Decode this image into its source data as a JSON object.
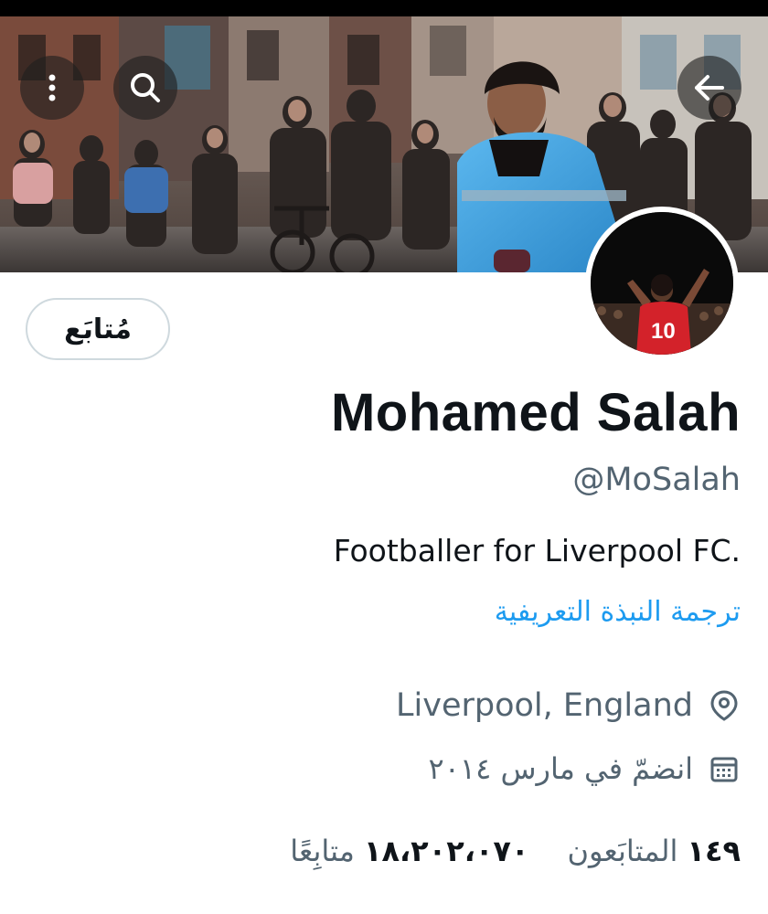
{
  "header": {
    "more_icon": "more-vertical-icon",
    "search_icon": "search-icon",
    "back_icon": "arrow-back-icon"
  },
  "profile": {
    "display_name": "Mohamed Salah",
    "handle": "@MoSalah",
    "bio": "Footballer for Liverpool FC.",
    "translate_bio_label": "ترجمة النبذة التعريفية",
    "location": "Liverpool, England",
    "location_icon": "location-pin-icon",
    "joined": "انضمّ في مارس ٢٠١٤",
    "joined_icon": "calendar-icon",
    "follow_button_label": "مُتابَع"
  },
  "stats": {
    "following_count": "١٤٩",
    "following_label": "المتابَعون",
    "followers_count": "١٨،٢٠٢،٠٧٠",
    "followers_label": "متابِعًا"
  },
  "colors": {
    "link": "#1d9bf0",
    "secondary_text": "#536471",
    "primary_text": "#0f1419",
    "border": "#cfd9de",
    "jacket_blue": "#3aa3e0",
    "liverpool_red": "#d3222a"
  }
}
